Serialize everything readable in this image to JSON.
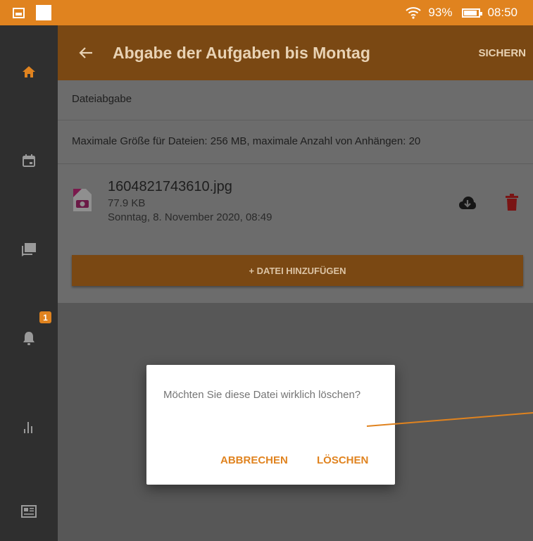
{
  "status_bar": {
    "battery": "93%",
    "time": "08:50",
    "icons": [
      "image-icon",
      "app-icon",
      "wifi-icon",
      "battery-icon"
    ]
  },
  "rail": {
    "items": [
      {
        "icon": "home-icon"
      },
      {
        "icon": "calendar-icon"
      },
      {
        "icon": "messages-icon"
      },
      {
        "icon": "bell-icon",
        "badge": "1"
      },
      {
        "icon": "chart-icon"
      },
      {
        "icon": "news-icon"
      }
    ]
  },
  "app_bar": {
    "title": "Abgabe der Aufgaben bis Montag",
    "save_label": "SICHERN"
  },
  "content": {
    "section_title": "Dateiabgabe",
    "info": "Maximale Größe für Dateien: 256 MB, maximale Anzahl von Anhängen: 20",
    "file": {
      "name": "1604821743610.jpg",
      "size": "77.9 KB",
      "date": "Sonntag, 8. November 2020, 08:49"
    },
    "add_file_label": "+ DATEI HINZUFÜGEN"
  },
  "dialog": {
    "message": "Möchten Sie diese Datei wirklich löschen?",
    "cancel_label": "ABBRECHEN",
    "delete_label": "LÖSCHEN"
  },
  "colors": {
    "accent": "#e0831f",
    "app_bar_dimmed": "#7a4813",
    "delete_icon": "#7a1414",
    "rail": "#2f2f2f"
  }
}
